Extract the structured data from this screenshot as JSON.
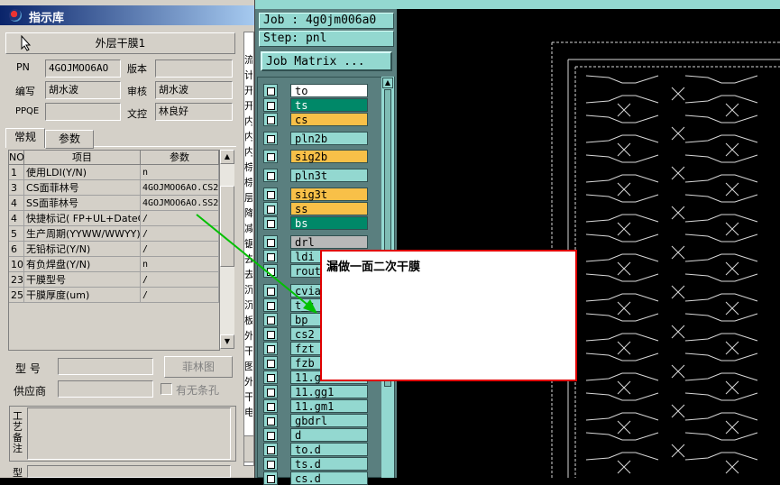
{
  "dialog": {
    "title": "指示库",
    "doc_name": "外层干膜1",
    "fields": {
      "pn_label": "PN",
      "pn_value": "4GOJMOO6AO",
      "version_label": "版本",
      "version_value": "",
      "author_label": "编写",
      "author_value": "胡水波",
      "review_label": "审核",
      "review_value": "胡水波",
      "ppqe_label": "PPQE",
      "ppqe_value": "",
      "doc_control_label": "文控",
      "doc_control_value": "林良好"
    },
    "tabs": [
      "常规",
      "参数"
    ],
    "grid": {
      "headers": [
        "NO",
        "项目",
        "参数"
      ],
      "rows": [
        {
          "no": "1",
          "item": "使用LDI(Y/N)",
          "param": "n"
        },
        {
          "no": "3",
          "item": "CS面菲林号",
          "param": "4GOJMOO6AO.CS2"
        },
        {
          "no": "4",
          "item": "SS面菲林号",
          "param": "4GOJMOO6AO.SS2"
        },
        {
          "no": "4",
          "item": "快捷标记( FP+UL+DateC",
          "param": "/"
        },
        {
          "no": "5",
          "item": "生产周期(YYWW/WWYY)",
          "param": "/"
        },
        {
          "no": "6",
          "item": "无铅标记(Y/N)",
          "param": "/"
        },
        {
          "no": "10",
          "item": "有负焊盘(Y/N)",
          "param": "n"
        },
        {
          "no": "23",
          "item": "干膜型号",
          "param": "/"
        },
        {
          "no": "25",
          "item": "干膜厚度(um)",
          "param": "/"
        }
      ]
    },
    "model_label": "型  号",
    "supplier_label": "供应商",
    "film_button": "菲林图",
    "no_strip_checkbox": "有无条孔",
    "process_remark_label": "工艺备注",
    "bottom_label": "型"
  },
  "genesis": {
    "job": "Job : 4g0jm006a0",
    "step": "Step: pnl",
    "matrix_button": "Job Matrix ...",
    "layers": [
      {
        "name": "to",
        "color": "#ffffff"
      },
      {
        "name": "ts",
        "color": "#008868"
      },
      {
        "name": "cs",
        "color": "#f8c048"
      },
      {
        "name": "pln2b",
        "color": "#93d8d0"
      },
      {
        "name": "sig2b",
        "color": "#f8c048"
      },
      {
        "name": "pln3t",
        "color": "#93d8d0"
      },
      {
        "name": "sig3t",
        "color": "#f8c048"
      },
      {
        "name": "ss",
        "color": "#f8c048"
      },
      {
        "name": "bs",
        "color": "#008868"
      },
      {
        "name": "drl",
        "color": "#b8b8b8"
      },
      {
        "name": "ldi",
        "color": "#93d8d0"
      },
      {
        "name": "rout",
        "color": "#93d8d0"
      },
      {
        "name": "cvia",
        "color": "#93d8d0"
      },
      {
        "name": "t_s",
        "color": "#93d8d0"
      },
      {
        "name": "bp",
        "color": "#93d8d0"
      },
      {
        "name": "cs2",
        "color": "#93d8d0"
      },
      {
        "name": "fzt",
        "color": "#93d8d0"
      },
      {
        "name": "fzb",
        "color": "#93d8d0"
      },
      {
        "name": "11.g",
        "color": "#93d8d0"
      },
      {
        "name": "11.gg1",
        "color": "#93d8d0"
      },
      {
        "name": "11.gm1",
        "color": "#93d8d0"
      },
      {
        "name": "gbdrl",
        "color": "#93d8d0"
      },
      {
        "name": "d",
        "color": "#93d8d0"
      },
      {
        "name": "to.d",
        "color": "#93d8d0"
      },
      {
        "name": "ts.d",
        "color": "#93d8d0"
      },
      {
        "name": "cs.d",
        "color": "#93d8d0"
      }
    ]
  },
  "strip_letters": [
    "流",
    "计",
    "开",
    "开",
    "内",
    "内",
    "内",
    "棕",
    "棕",
    "层",
    "降",
    "减",
    "锯",
    "去",
    "去",
    "沉",
    "沉",
    "板",
    "外",
    "干",
    "图",
    "外",
    "干",
    "电"
  ],
  "annotation": {
    "text": "漏做一面二次干膜",
    "border_color": "#e00000",
    "arrow_color": "#00c000"
  }
}
